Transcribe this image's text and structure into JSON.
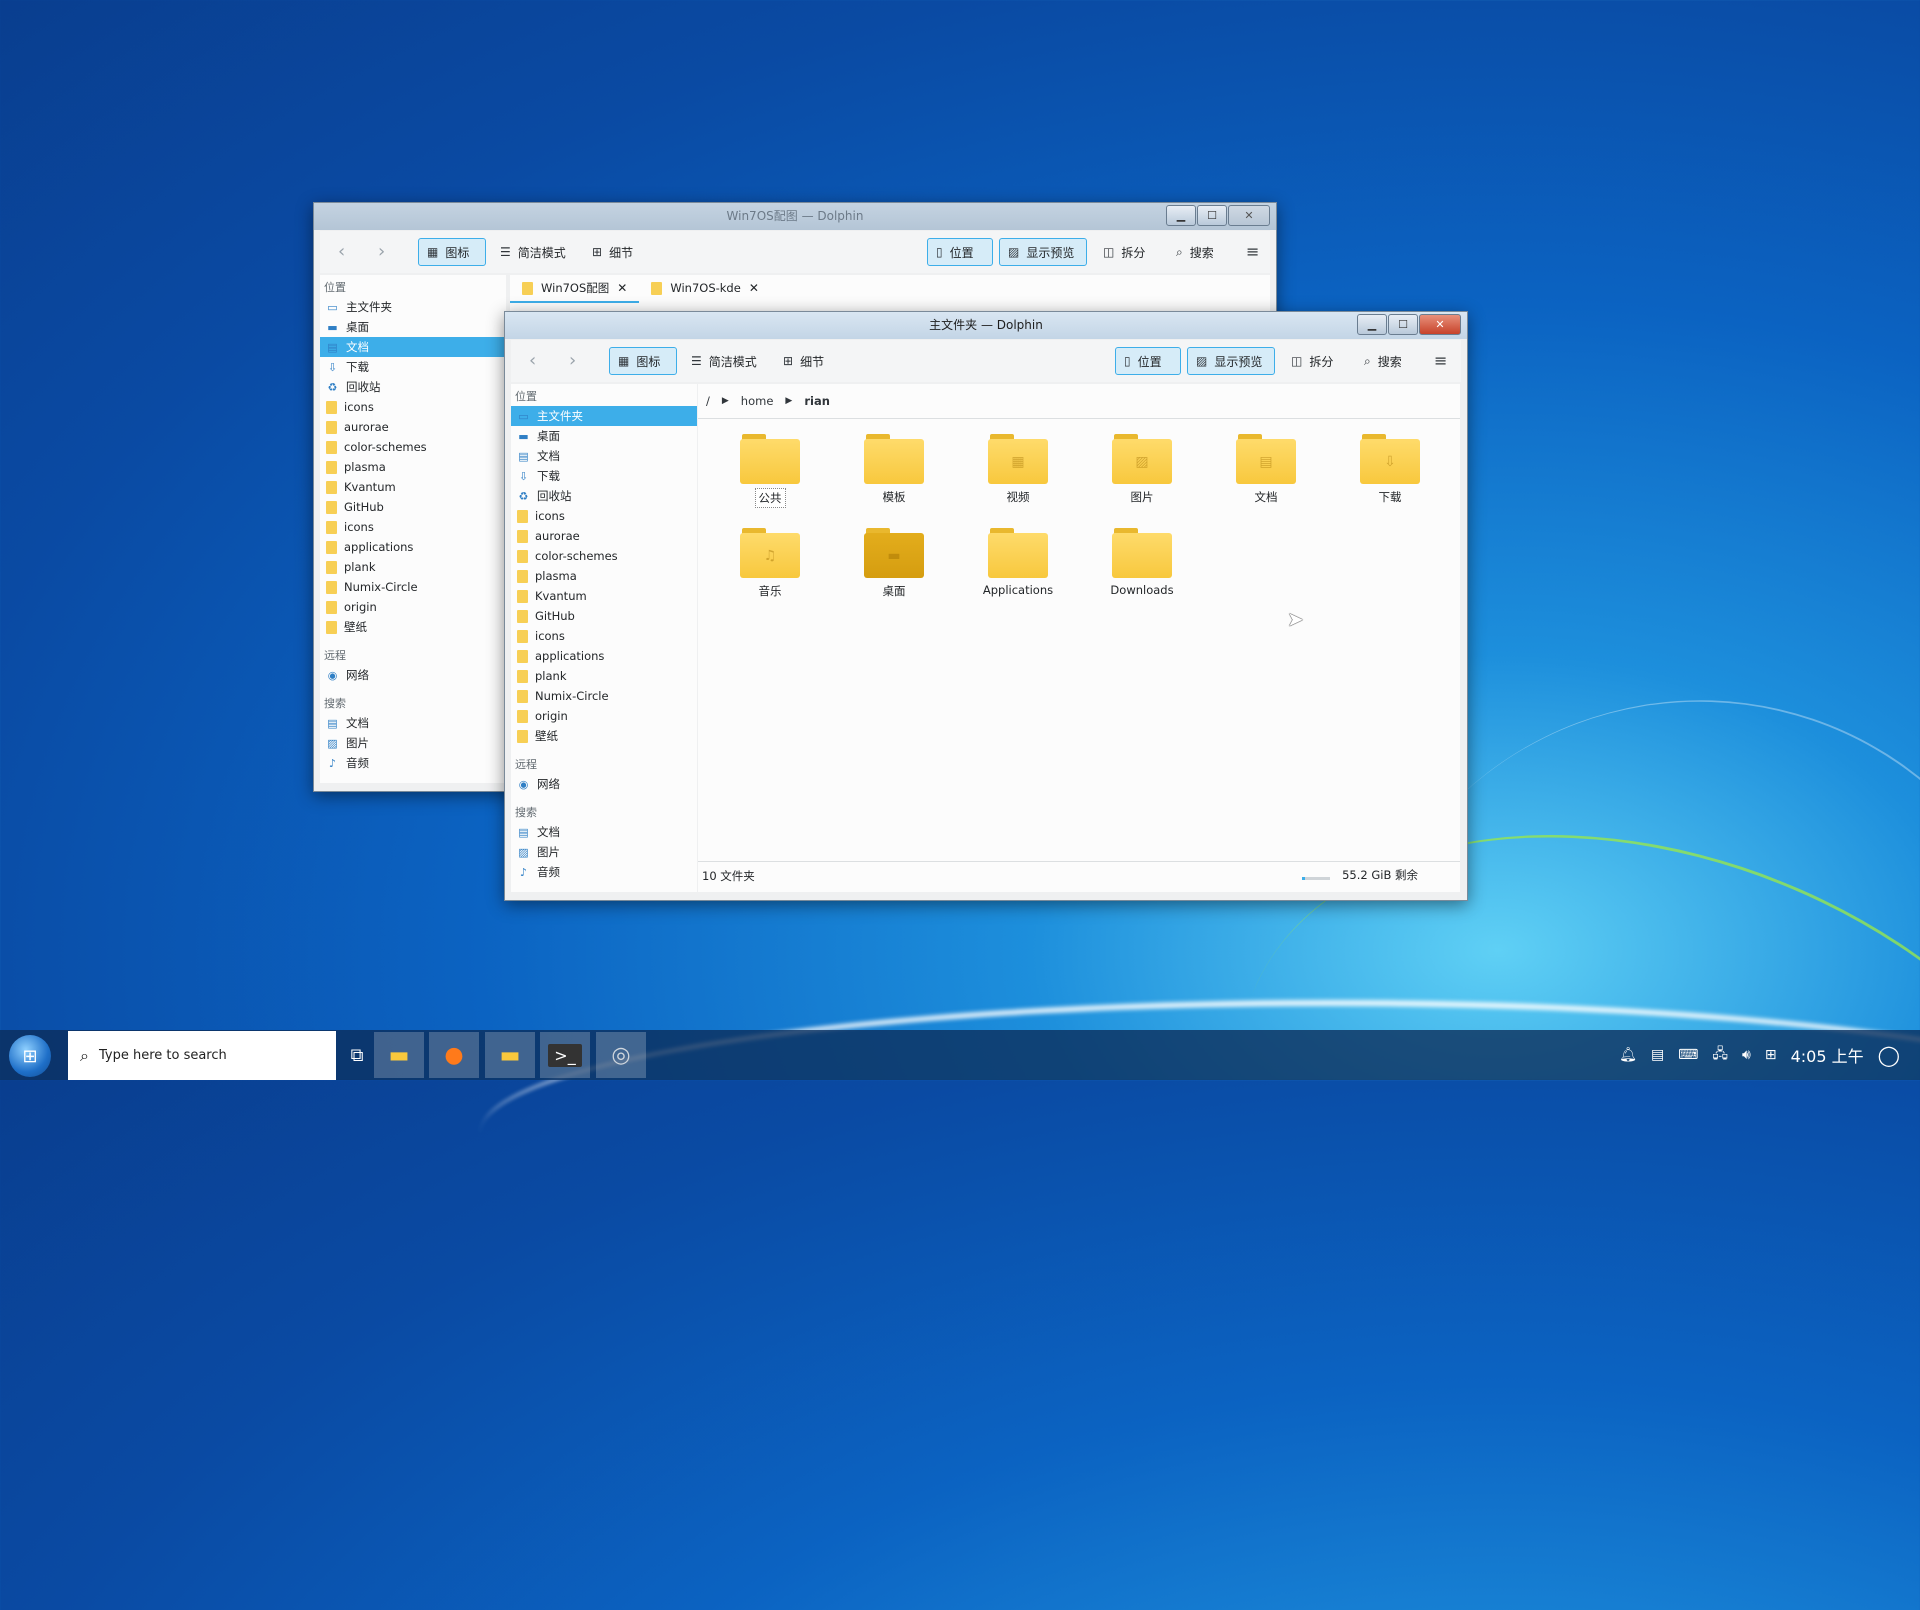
{
  "colors": {
    "accent": "#3daee9",
    "folder": "#f8c83d",
    "taskbar": "#0c2d5a"
  },
  "back_window": {
    "title": "Win7OS配图 — Dolphin",
    "toolbar": {
      "icons": "图标",
      "compact": "简洁模式",
      "details": "细节",
      "places": "位置",
      "preview": "显示预览",
      "split": "拆分",
      "search": "搜索"
    },
    "tabs": [
      {
        "label": "Win7OS配图"
      },
      {
        "label": "Win7OS-kde"
      }
    ],
    "sidebar": {
      "places_header": "位置",
      "places": [
        "主文件夹",
        "桌面",
        "文档",
        "下载",
        "回收站",
        "icons",
        "aurorae",
        "color-schemes",
        "plasma",
        "Kvantum",
        "GitHub",
        "icons",
        "applications",
        "plank",
        "Numix-Circle",
        "origin",
        "壁纸"
      ],
      "remote_header": "远程",
      "network": "网络",
      "search_header": "搜索",
      "search_items": [
        "文档",
        "图片",
        "音频"
      ]
    }
  },
  "front_window": {
    "title": "主文件夹 — Dolphin",
    "toolbar": {
      "icons": "图标",
      "compact": "简洁模式",
      "details": "细节",
      "places": "位置",
      "preview": "显示预览",
      "split": "拆分",
      "search": "搜索"
    },
    "breadcrumb": [
      "/",
      "home",
      "rian"
    ],
    "sidebar": {
      "places_header": "位置",
      "places": [
        "主文件夹",
        "桌面",
        "文档",
        "下载",
        "回收站",
        "icons",
        "aurorae",
        "color-schemes",
        "plasma",
        "Kvantum",
        "GitHub",
        "icons",
        "applications",
        "plank",
        "Numix-Circle",
        "origin",
        "壁纸"
      ],
      "remote_header": "远程",
      "network": "网络",
      "search_header": "搜索",
      "search_items": [
        "文档",
        "图片",
        "音频"
      ]
    },
    "files": [
      {
        "name": "公共",
        "emblem": ""
      },
      {
        "name": "模板",
        "emblem": ""
      },
      {
        "name": "视频",
        "emblem": "▦"
      },
      {
        "name": "图片",
        "emblem": "▨"
      },
      {
        "name": "文档",
        "emblem": "▤"
      },
      {
        "name": "下载",
        "emblem": "⇩"
      },
      {
        "name": "音乐",
        "emblem": "♫"
      },
      {
        "name": "桌面",
        "emblem": "▬"
      },
      {
        "name": "Applications",
        "emblem": ""
      },
      {
        "name": "Downloads",
        "emblem": ""
      }
    ],
    "status": {
      "count": "10 文件夹",
      "free": "55.2 GiB 剩余",
      "used_fraction": 0.12
    }
  },
  "taskbar": {
    "search_placeholder": "Type here to search",
    "apps": [
      "task-view",
      "file-manager",
      "firefox",
      "folder",
      "terminal",
      "settings"
    ],
    "clock": "4:05 上午"
  }
}
